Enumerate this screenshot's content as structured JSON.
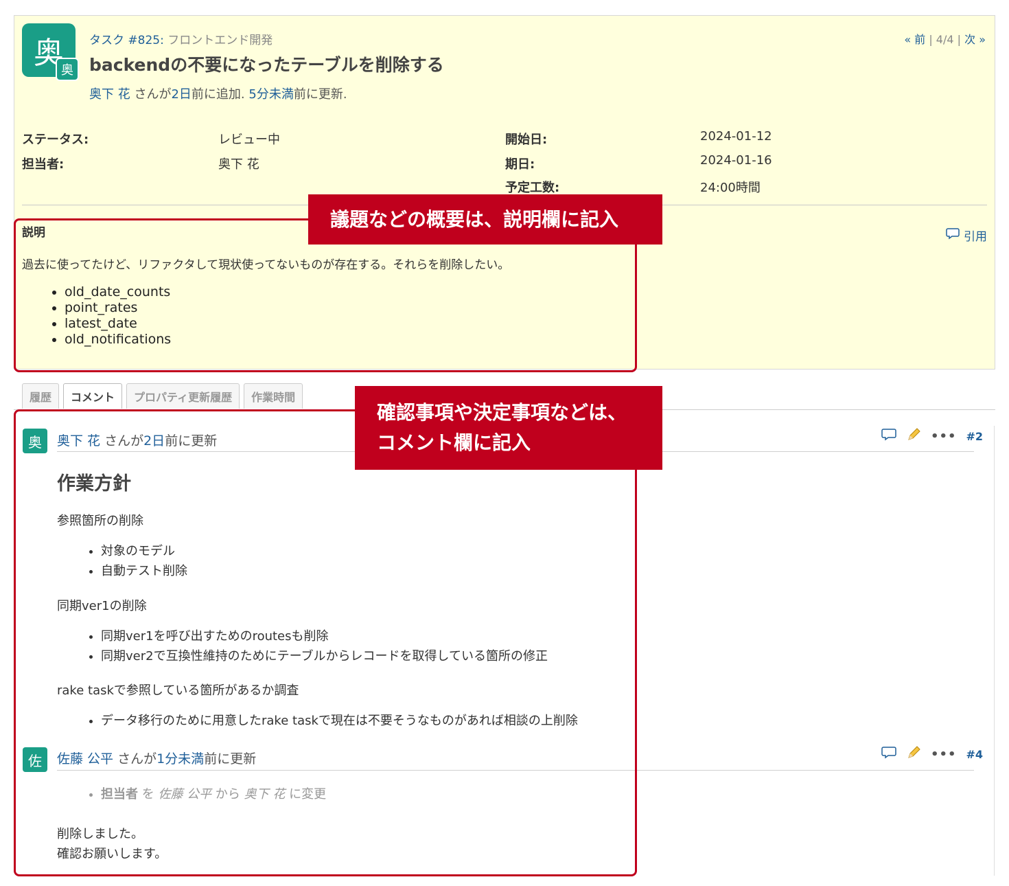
{
  "issue": {
    "avatar_char": "奥",
    "avatar_small_char": "奥",
    "tracker": "タスク #825",
    "project_sep": ":",
    "project": "フロントエンド開発",
    "title": "backendの不要になったテーブルを削除する",
    "author": "奥下 花",
    "author_mid": " さんが",
    "added_ago": "2日",
    "added_suffix": "前に追加.",
    "updated_ago": "5分未満",
    "updated_suffix": "前に更新.",
    "pager": {
      "prev": "« 前",
      "sep1": " | ",
      "position": "4/4",
      "sep2": " | ",
      "next": "次 »"
    },
    "attributes": {
      "status_label": "ステータス:",
      "status_value": "レビュー中",
      "assignee_label": "担当者:",
      "assignee_value": "奥下 花",
      "start_label": "開始日:",
      "start_value": "2024-01-12",
      "due_label": "期日:",
      "due_value": "2024-01-16",
      "estimate_label": "予定工数:",
      "estimate_value": "24:00時間"
    },
    "description": {
      "title": "説明",
      "quote": "引用",
      "text": "過去に使ってたけど、リファクタして現状使ってないものが存在する。それらを削除したい。",
      "items": [
        "old_date_counts",
        "point_rates",
        "latest_date",
        "old_notifications"
      ]
    }
  },
  "tabs": [
    "履歴",
    "コメント",
    "プロパティ更新履歴",
    "作業時間"
  ],
  "journals": [
    {
      "avatar_char": "奥",
      "author": "奥下 花",
      "mid": " さんが",
      "ago": "2日",
      "suffix": "前に更新",
      "number": "#2",
      "heading": "作業方針",
      "p1": "参照箇所の削除",
      "list1": [
        "対象のモデル",
        "自動テスト削除"
      ],
      "p2": "同期ver1の削除",
      "list2": [
        "同期ver1を呼び出すためのroutesも削除",
        "同期ver2で互換性維持のためにテーブルからレコードを取得している箇所の修正"
      ],
      "p3": "rake taskで参照している箇所があるか調査",
      "list3": [
        "データ移行のために用意したrake taskで現在は不要そうなものがあれば相談の上削除"
      ]
    },
    {
      "avatar_char": "佐",
      "author": "佐藤 公平",
      "mid": " さんが",
      "ago": "1分未満",
      "suffix": "前に更新",
      "number": "#4",
      "detail": {
        "field": "担当者",
        "w1": " を ",
        "old": "佐藤 公平",
        "w2": " から ",
        "new": "奥下 花",
        "w3": " に変更"
      },
      "note1": "削除しました。",
      "note2": "確認お願いします。"
    }
  ],
  "callouts": {
    "description": "議題などの概要は、説明欄に記入",
    "comment_line1": "確認事項や決定事項などは、",
    "comment_line2": "コメント欄に記入"
  },
  "colors": {
    "accent": "#1a9e87",
    "callout": "#c0001d",
    "link": "#1f5f99",
    "issue_bg": "#ffffdd"
  }
}
